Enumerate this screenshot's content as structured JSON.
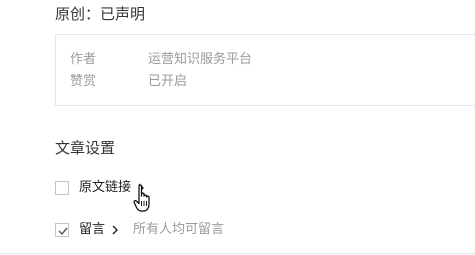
{
  "originality": {
    "status_text": "原创：已声明"
  },
  "info_box": {
    "author": {
      "label": "作者",
      "value": "运营知识服务平台"
    },
    "reward": {
      "label": "赞赏",
      "value": "已开启"
    }
  },
  "article_settings": {
    "title": "文章设置",
    "original_link": {
      "label": "原文链接",
      "checked": false
    },
    "comments": {
      "label": "留言",
      "checked": true,
      "note": "所有人均可留言"
    }
  },
  "colors": {
    "text_primary": "#353535",
    "text_secondary": "#9a9a9a",
    "border": "#e7e7eb"
  },
  "icons": {
    "cursor": "hand-pointer-icon",
    "chevron": "chevron-right-icon",
    "check": "checkmark-icon"
  }
}
